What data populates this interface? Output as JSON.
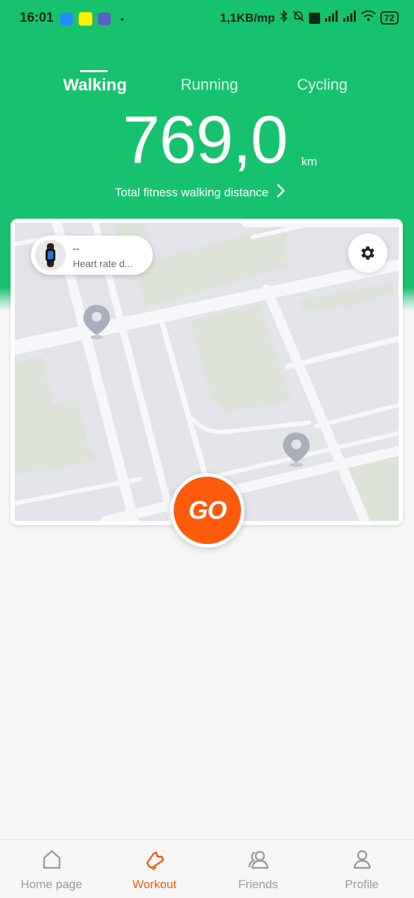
{
  "status_bar": {
    "time": "16:01",
    "speed": "1,1KB/mp",
    "battery": "72",
    "dot": "•"
  },
  "tabs": [
    {
      "label": "Walking",
      "active": true
    },
    {
      "label": "Running",
      "active": false
    },
    {
      "label": "Cycling",
      "active": false
    }
  ],
  "summary": {
    "distance": "769,0",
    "unit": "km",
    "subtitle": "Total fitness walking distance"
  },
  "device": {
    "name": "--",
    "status": "Heart rate d..."
  },
  "go_label": "GO",
  "bottom_nav": [
    {
      "label": "Home page",
      "icon": "home-icon",
      "active": false
    },
    {
      "label": "Workout",
      "icon": "sneaker-icon",
      "active": true
    },
    {
      "label": "Friends",
      "icon": "friends-icon",
      "active": false
    },
    {
      "label": "Profile",
      "icon": "profile-icon",
      "active": false
    }
  ],
  "colors": {
    "primary_green": "#17c26e",
    "accent_orange": "#fd5a0c",
    "inactive_gray": "#9a9a9a"
  }
}
